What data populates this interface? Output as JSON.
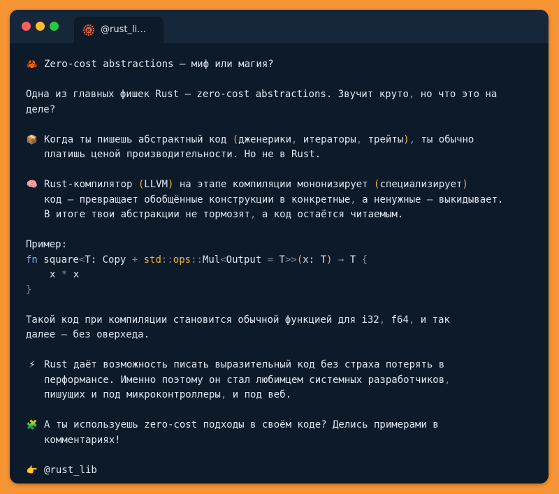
{
  "window": {
    "tab_title": "@rust_li…"
  },
  "post": {
    "title_emoji": "🦀",
    "title": "Zero-cost abstractions — миф или магия?",
    "intro_1a": "Одна из главных фишек Rust — zero-cost abstractions. Звучит круто",
    "intro_1b": " но что это на",
    "intro_2": "деле?",
    "p1_emoji": "📦",
    "p1_l1a": "Когда ты пишешь абстрактный код ",
    "p1_l1b": "дженерики",
    "p1_l1c": " итераторы",
    "p1_l1d": " трейты",
    "p1_l1e": " ты обычно",
    "p1_l2": "платишь ценой производительности. Но не в Rust.",
    "p2_emoji": "🧠",
    "p2_l1a": "Rust-компилятор ",
    "p2_l1b": "LLVM",
    "p2_l1c": " на этапе компиляции мононизирует ",
    "p2_l1d": "специализирует",
    "p2_l2a": "код — превращает обобщённые конструкции в конкретные",
    "p2_l2b": " а ненужные — выкидывает.",
    "p2_l3a": "В итоге твои абстракции не тормозят",
    "p2_l3b": " а код остаётся читаемым.",
    "example_label": "Пример:",
    "code": {
      "fn": "fn",
      "name": " square",
      "generic_open": "<",
      "T": "T",
      "colon": ": ",
      "copy": "Copy",
      "plus": " + ",
      "std": "std",
      "path_sep1": "::",
      "ops": "ops",
      "path_sep2": "::",
      "mul": "Mul",
      "lt": "<",
      "output": "Output",
      "eq": " = ",
      "T2": "T",
      "gtgt": ">>",
      "paren_open": "(",
      "arg": "x",
      "arg_colon": ": ",
      "T3": "T",
      "paren_close": ")",
      "arrow": " → ",
      "ret": "T",
      "brace_open": " {",
      "body_x1": "x",
      "body_mul": " * ",
      "body_x2": "x",
      "brace_close": "}"
    },
    "p3_l1a": "Такой код при компиляции становится обычной функцией для i32",
    "p3_l1b": " f64",
    "p3_l1c": " и так",
    "p3_l2": "далее — без оверхеда.",
    "p4_emoji": "⚡",
    "p4_l1": "Rust даёт возможность писать выразительный код без страха потерять в",
    "p4_l2a": "перформансе. Именно поэтому он стал любимцем системных разработчиков",
    "p4_l3a": "пишущих и под микроконтроллеры",
    "p4_l3b": " и под веб.",
    "p5_emoji": "🧩",
    "p5_l1": "А ты используешь zero-cost подходы в своём коде? Делись примерами в",
    "p5_l2": "комментариях!",
    "footer_emoji": "👉",
    "footer": "@rust_lib",
    "comma": ",",
    "lparen": "(",
    "rparen": ")"
  }
}
